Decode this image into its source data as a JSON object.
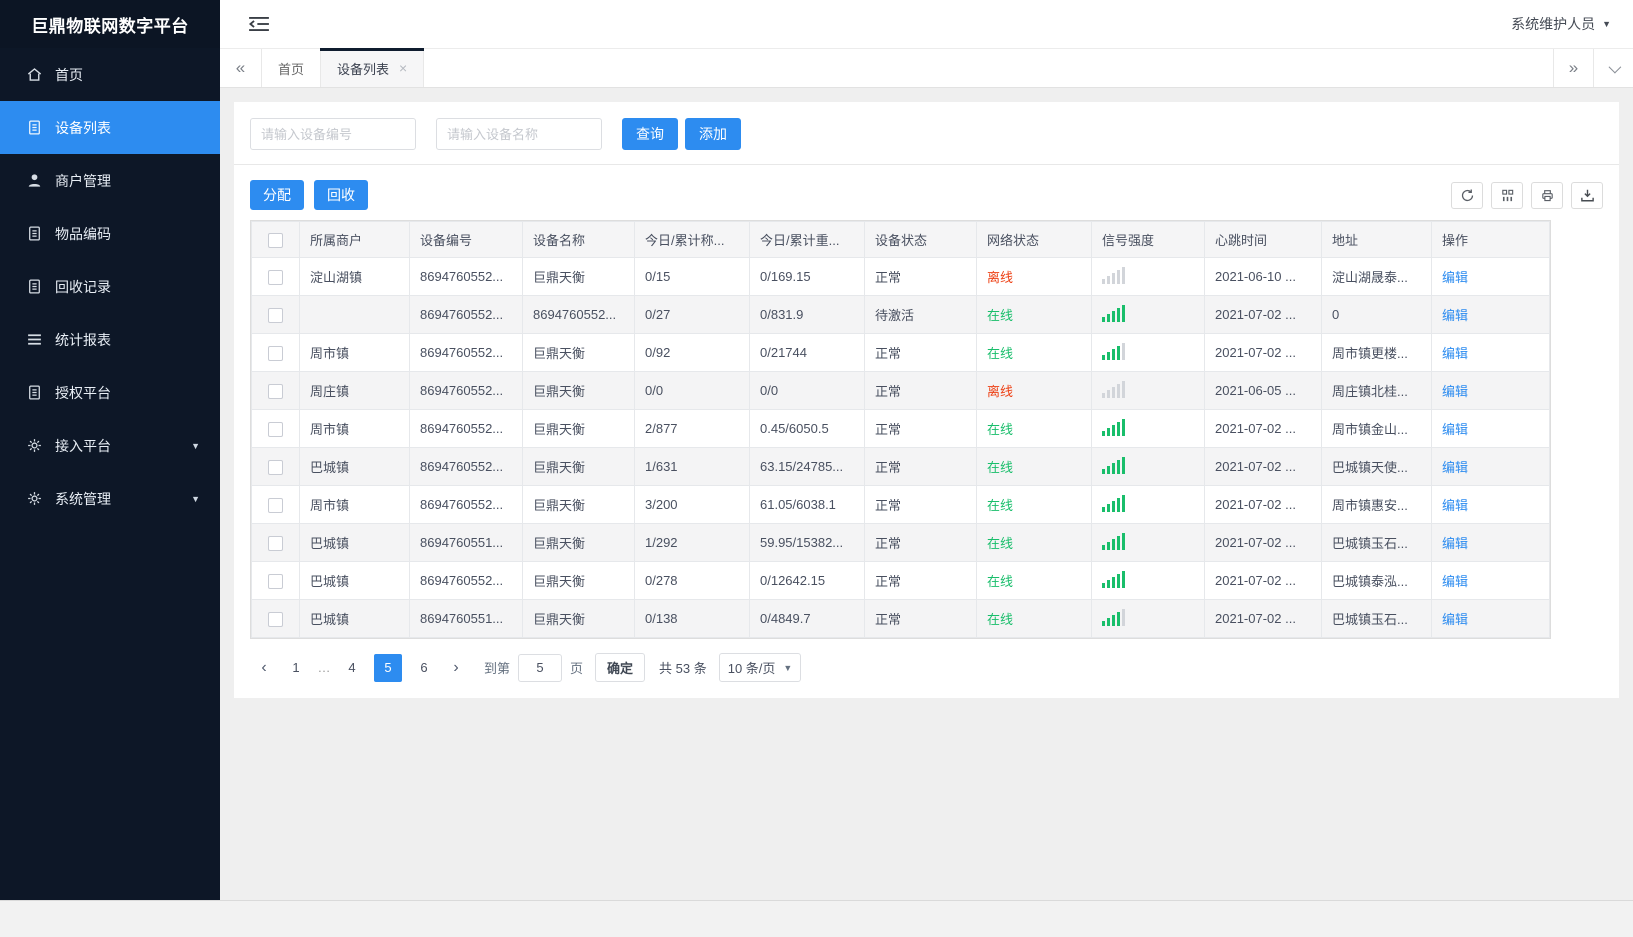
{
  "app": {
    "title": "巨鼎物联网数字平台",
    "user": "系统维护人员"
  },
  "colors": {
    "accent": "#2d8cf0",
    "success": "#19be6b",
    "danger": "#ed4014",
    "sidebar_bg": "#0d1727"
  },
  "sidebar": {
    "items": [
      {
        "label": "首页",
        "icon": "home",
        "active": false,
        "arrow": false
      },
      {
        "label": "设备列表",
        "icon": "doc",
        "active": true,
        "arrow": false
      },
      {
        "label": "商户管理",
        "icon": "user",
        "active": false,
        "arrow": false
      },
      {
        "label": "物品编码",
        "icon": "doc",
        "active": false,
        "arrow": false
      },
      {
        "label": "回收记录",
        "icon": "doc",
        "active": false,
        "arrow": false
      },
      {
        "label": "统计报表",
        "icon": "lines",
        "active": false,
        "arrow": false
      },
      {
        "label": "授权平台",
        "icon": "doc",
        "active": false,
        "arrow": false
      },
      {
        "label": "接入平台",
        "icon": "gear",
        "active": false,
        "arrow": true
      },
      {
        "label": "系统管理",
        "icon": "gear",
        "active": false,
        "arrow": true
      }
    ]
  },
  "tabs": [
    {
      "label": "首页",
      "active": false,
      "closable": false
    },
    {
      "label": "设备列表",
      "active": true,
      "closable": true
    }
  ],
  "search": {
    "device_no_placeholder": "请输入设备编号",
    "device_name_placeholder": "请输入设备名称",
    "query_label": "查询",
    "add_label": "添加"
  },
  "toolbar": {
    "assign_label": "分配",
    "recycle_label": "回收",
    "icons": [
      "refresh",
      "columns",
      "print",
      "export"
    ]
  },
  "table": {
    "columns": [
      "所属商户",
      "设备编号",
      "设备名称",
      "今日/累计称...",
      "今日/累计重...",
      "设备状态",
      "网络状态",
      "信号强度",
      "心跳时间",
      "地址",
      "操作"
    ],
    "edit_label": "编辑",
    "rows": [
      {
        "merchant": "淀山湖镇",
        "device_no": "8694760552...",
        "device_name": "巨鼎天衡",
        "today_total_count": "0/15",
        "today_total_weight": "0/169.15",
        "device_status": "正常",
        "network_status": "离线",
        "online": false,
        "signal_bars": 0,
        "heartbeat": "2021-06-10 ...",
        "address": "淀山湖晟泰..."
      },
      {
        "merchant": "",
        "device_no": "8694760552...",
        "device_name": "8694760552...",
        "today_total_count": "0/27",
        "today_total_weight": "0/831.9",
        "device_status": "待激活",
        "network_status": "在线",
        "online": true,
        "signal_bars": 5,
        "heartbeat": "2021-07-02 ...",
        "address": "0"
      },
      {
        "merchant": "周市镇",
        "device_no": "8694760552...",
        "device_name": "巨鼎天衡",
        "today_total_count": "0/92",
        "today_total_weight": "0/21744",
        "device_status": "正常",
        "network_status": "在线",
        "online": true,
        "signal_bars": 4,
        "heartbeat": "2021-07-02 ...",
        "address": "周市镇更楼..."
      },
      {
        "merchant": "周庄镇",
        "device_no": "8694760552...",
        "device_name": "巨鼎天衡",
        "today_total_count": "0/0",
        "today_total_weight": "0/0",
        "device_status": "正常",
        "network_status": "离线",
        "online": false,
        "signal_bars": 0,
        "heartbeat": "2021-06-05 ...",
        "address": "周庄镇北桂..."
      },
      {
        "merchant": "周市镇",
        "device_no": "8694760552...",
        "device_name": "巨鼎天衡",
        "today_total_count": "2/877",
        "today_total_weight": "0.45/6050.5",
        "device_status": "正常",
        "network_status": "在线",
        "online": true,
        "signal_bars": 5,
        "heartbeat": "2021-07-02 ...",
        "address": "周市镇金山..."
      },
      {
        "merchant": "巴城镇",
        "device_no": "8694760552...",
        "device_name": "巨鼎天衡",
        "today_total_count": "1/631",
        "today_total_weight": "63.15/24785...",
        "device_status": "正常",
        "network_status": "在线",
        "online": true,
        "signal_bars": 5,
        "heartbeat": "2021-07-02 ...",
        "address": "巴城镇天使..."
      },
      {
        "merchant": "周市镇",
        "device_no": "8694760552...",
        "device_name": "巨鼎天衡",
        "today_total_count": "3/200",
        "today_total_weight": "61.05/6038.1",
        "device_status": "正常",
        "network_status": "在线",
        "online": true,
        "signal_bars": 5,
        "heartbeat": "2021-07-02 ...",
        "address": "周市镇惠安..."
      },
      {
        "merchant": "巴城镇",
        "device_no": "8694760551...",
        "device_name": "巨鼎天衡",
        "today_total_count": "1/292",
        "today_total_weight": "59.95/15382...",
        "device_status": "正常",
        "network_status": "在线",
        "online": true,
        "signal_bars": 5,
        "heartbeat": "2021-07-02 ...",
        "address": "巴城镇玉石..."
      },
      {
        "merchant": "巴城镇",
        "device_no": "8694760552...",
        "device_name": "巨鼎天衡",
        "today_total_count": "0/278",
        "today_total_weight": "0/12642.15",
        "device_status": "正常",
        "network_status": "在线",
        "online": true,
        "signal_bars": 5,
        "heartbeat": "2021-07-02 ...",
        "address": "巴城镇泰泓..."
      },
      {
        "merchant": "巴城镇",
        "device_no": "8694760551...",
        "device_name": "巨鼎天衡",
        "today_total_count": "0/138",
        "today_total_weight": "0/4849.7",
        "device_status": "正常",
        "network_status": "在线",
        "online": true,
        "signal_bars": 4,
        "heartbeat": "2021-07-02 ...",
        "address": "巴城镇玉石..."
      }
    ]
  },
  "pagination": {
    "pages": [
      "1",
      "...",
      "4",
      "5",
      "6"
    ],
    "active_page": "5",
    "goto_label": "到第",
    "page_input_value": "5",
    "page_unit_label": "页",
    "confirm_label": "确定",
    "total_label": "共 53 条",
    "page_size_label": "10 条/页"
  }
}
